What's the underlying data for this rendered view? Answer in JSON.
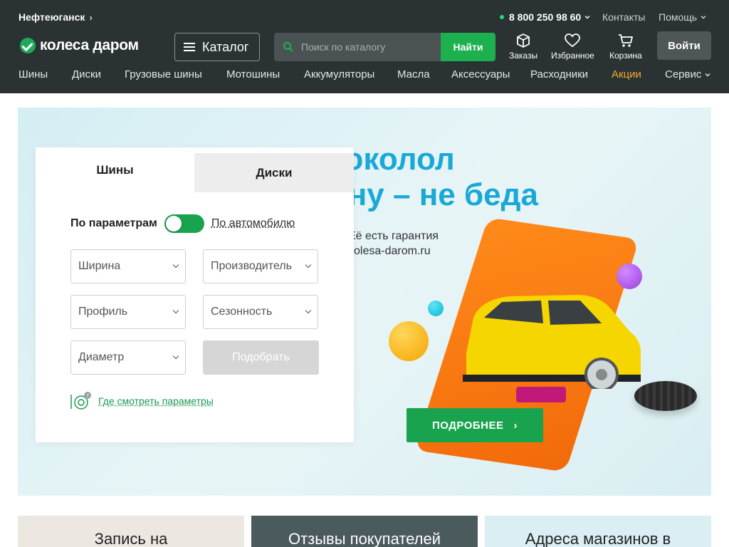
{
  "header": {
    "city": "Нефтеюганск",
    "phone": "8 800 250 98 60",
    "contacts": "Контакты",
    "help": "Помощь",
    "logo": "колеса даром",
    "catalog_label": "Каталог",
    "search_placeholder": "Поиск по каталогу",
    "search_button": "Найти",
    "orders": "Заказы",
    "favorites": "Избранное",
    "cart": "Корзина",
    "login": "Войти"
  },
  "nav": {
    "items": [
      "Шины",
      "Диски",
      "Грузовые шины",
      "Мотошины",
      "Аккумуляторы",
      "Масла",
      "Аксессуары",
      "Расходники",
      "Акции",
      "Сервис"
    ]
  },
  "banner": {
    "title_line1": "Проколол",
    "title_line2": "шину – не беда",
    "sub_line1": "Её есть гарантия",
    "sub_line2": "kolesa-darom.ru",
    "more_button": "ПОДРОБНЕЕ"
  },
  "selector": {
    "tab_tires": "Шины",
    "tab_disks": "Диски",
    "by_params": "По параметрам",
    "by_car": "По автомобилю",
    "width": "Ширина",
    "manufacturer": "Производитель",
    "profile": "Профиль",
    "season": "Сезонность",
    "diameter": "Диаметр",
    "pick_button": "Подобрать",
    "where_params": "Где смотреть параметры"
  },
  "cards": {
    "c1": "Запись на",
    "c2": "Отзывы покупателей",
    "c3": "Адреса магазинов в"
  },
  "colors": {
    "header_bg": "#2b3234",
    "accent_green": "#1aa34f",
    "promo_orange": "#f7a928",
    "banner_blue": "#1aa8d6"
  }
}
